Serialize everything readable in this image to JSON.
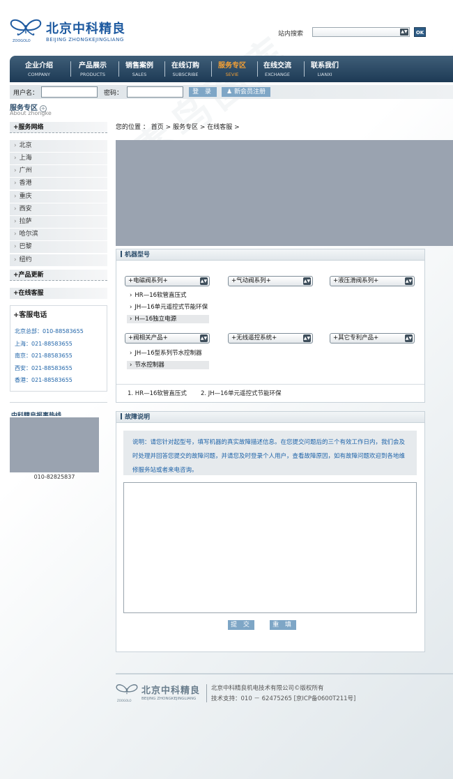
{
  "header": {
    "brand_cn": "北京中科精良",
    "brand_en": "BEIJING ZHONGKEJINGLIANG",
    "brand_tiny": "ZOOGOLO",
    "search_label": "站内搜索",
    "search_ok": "OK"
  },
  "nav": {
    "items": [
      {
        "cn": "企业介绍",
        "en": "COMPANY"
      },
      {
        "cn": "产品展示",
        "en": "PRODUCTS"
      },
      {
        "cn": "销售案例",
        "en": "SALES"
      },
      {
        "cn": "在线订购",
        "en": "SUBSCRIBE"
      },
      {
        "cn": "服务专区",
        "en": "SEVIE"
      },
      {
        "cn": "在线交流",
        "en": "EXCHANGE"
      },
      {
        "cn": "联系我们",
        "en": "LIANXI"
      }
    ],
    "active_index": 4,
    "active_color": "#f4a035"
  },
  "login": {
    "user_label": "用户名：",
    "pwd_label": "密码：",
    "login_button": "登 录",
    "register_button": "新会员注册"
  },
  "section": {
    "title": "服务专区",
    "subtitle": "About zhongke"
  },
  "sidebar": {
    "network_title": "+服务网络",
    "cities": [
      "北京",
      "上海",
      "广州",
      "香港",
      "重庆",
      "西安",
      "拉萨",
      "哈尔滨",
      "巴黎",
      "纽约"
    ],
    "product_update": "+产品更新",
    "online_service": "+在线客服",
    "hotline_title": "+客服电话",
    "hotlines": [
      "北京总部：010-88583655",
      "上海：021-88583655",
      "南京：021-88583655",
      "西安：021-88583655",
      "香港：021-88583655"
    ],
    "hotline2_title": "中科精良报事热线",
    "hotline2_number": "010-82825837"
  },
  "main": {
    "breadcrumb": "您的位置 ： 首页 > 服务专区 > 在线客服 >",
    "machine_title": "机器型号",
    "dropdowns_row1": [
      "+电磁阀系列+",
      "+气动阀系列+",
      "+液压滑阀系列+"
    ],
    "subs_row1": [
      "HR—16软管直压式",
      "JH—16单元遥控式节能环保",
      "H—16独立电源"
    ],
    "dropdowns_row2": [
      "+阀相关产品+",
      "+无线遥控系统+",
      "+其它专利产品+"
    ],
    "subs_row2": [
      "JH—16型系列节水控制器",
      "节水控制器"
    ],
    "summary": [
      "1. HR—16软管直压式",
      "2. JH—16单元遥控式节能环保"
    ],
    "fault_title": "故障说明",
    "fault_note": "说明：请您针对起型号，填写机器的真实故障描述信息。在您提交问题后的三个有效工作日内，我们会及时处理并回答您提交的故障问题，并请您及时登录个人用户，查看故障原因，如有故障问题欢迎到各地维修服务站或者来电咨询。",
    "submit_button": "提 交",
    "reset_button": "重 填"
  },
  "footer": {
    "brand_cn": "北京中科精良",
    "brand_en": "BEIJING ZHONGKEJINGLIANG",
    "brand_tiny": "ZOOGOLO",
    "copyright": "北京中科精良机电技术有限公司©版权所有",
    "support": "技术支持：010 － 62475265 [京ICP备0600T211号]"
  },
  "watermark": "素鸟图库",
  "colors": {
    "brand_blue": "#1e5aa0",
    "nav_dark": "#1d3a55",
    "button_blue": "#7ea6c6",
    "link_blue": "#1e63a8",
    "placeholder_gray": "#9aa3b0"
  }
}
